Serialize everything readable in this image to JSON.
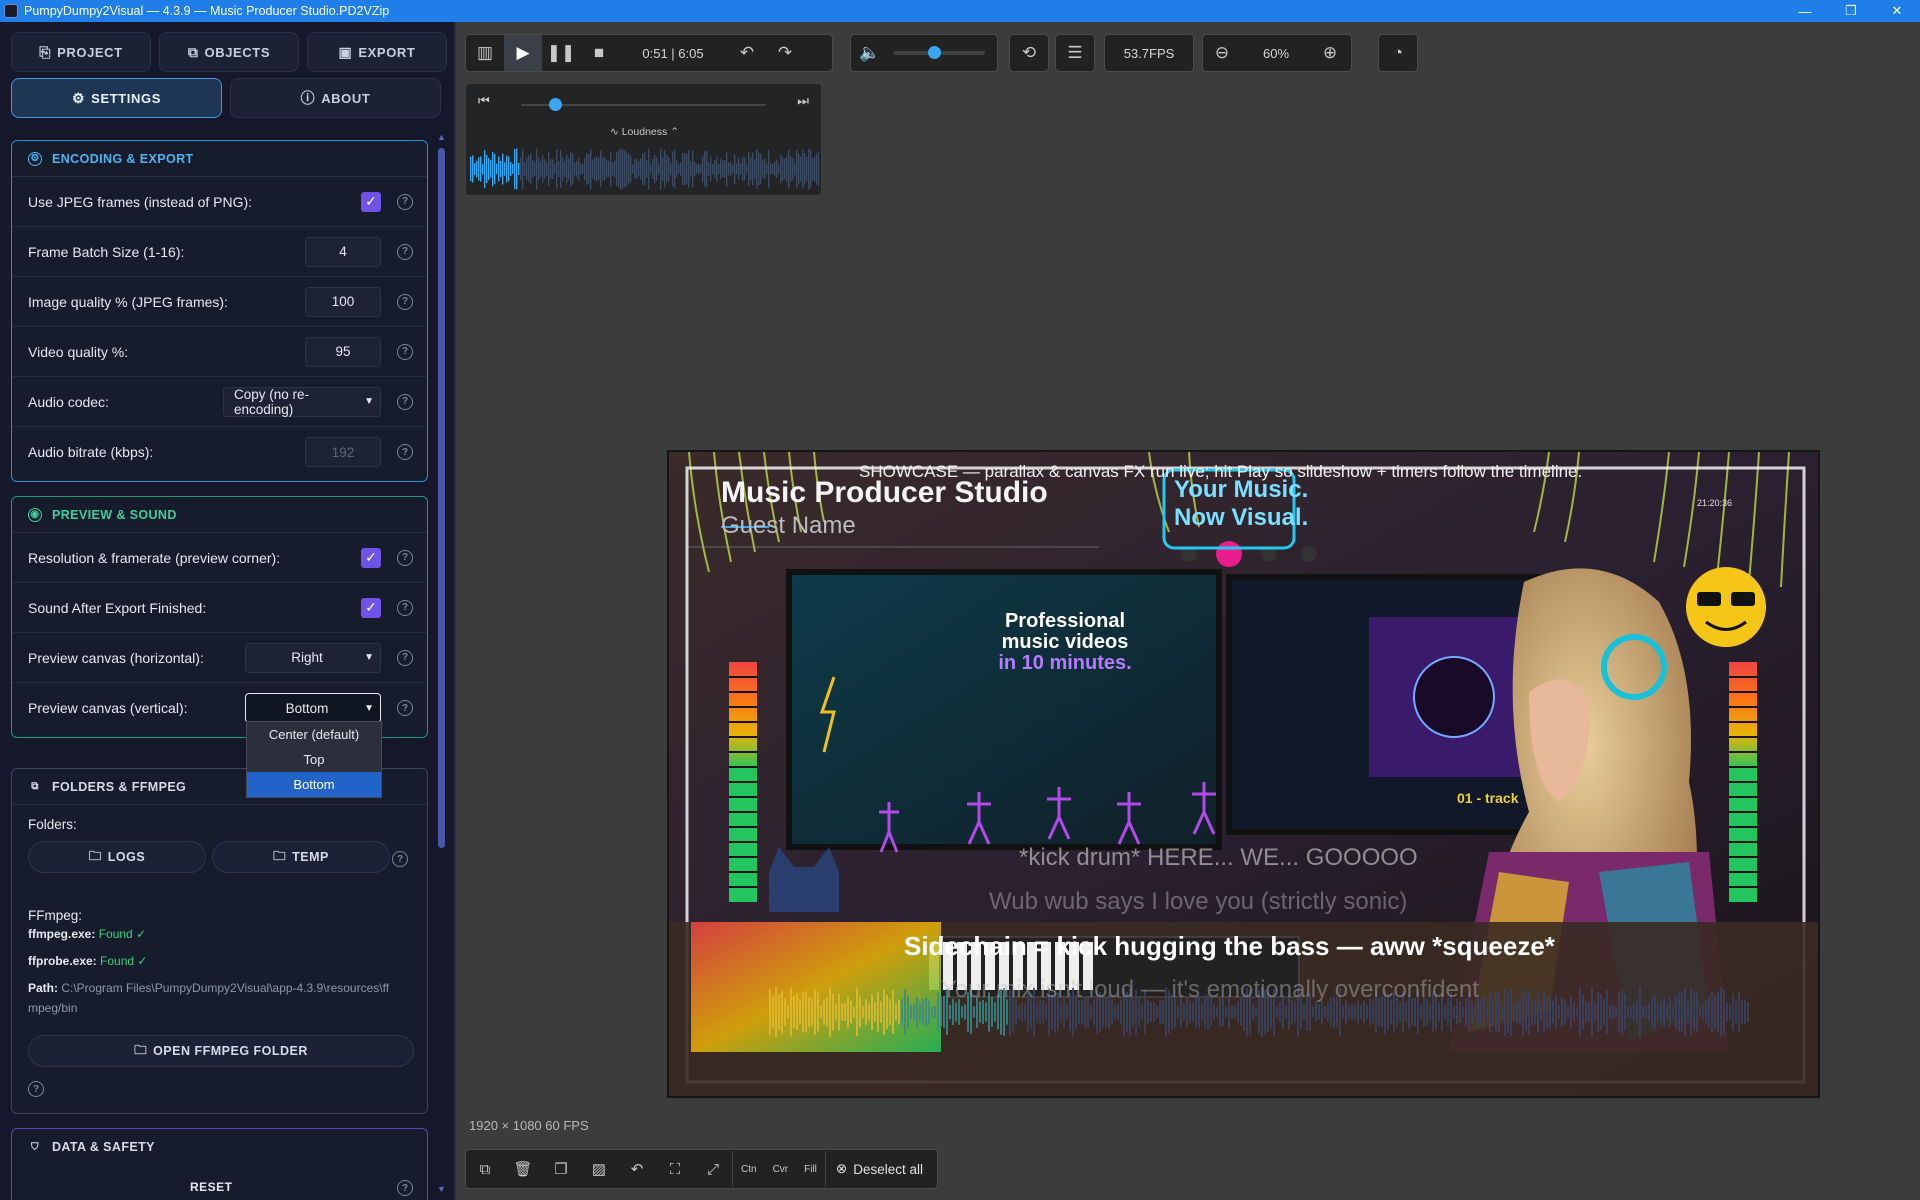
{
  "titlebar": {
    "title": "PumpyDumpy2Visual — 4.3.9 — Music Producer Studio.PD2VZip",
    "minimize": "—",
    "maximize": "❐",
    "close": "✕"
  },
  "sidebar": {
    "nav": [
      {
        "label": "PROJECT",
        "icon": "project-icon"
      },
      {
        "label": "OBJECTS",
        "icon": "objects-icon"
      },
      {
        "label": "EXPORT",
        "icon": "export-icon"
      }
    ],
    "nav2": [
      {
        "label": "SETTINGS",
        "icon": "gear-icon",
        "active": true
      },
      {
        "label": "ABOUT",
        "icon": "help-icon"
      }
    ],
    "encoding": {
      "title": "ENCODING & EXPORT",
      "rows": [
        {
          "label": "Use JPEG frames (instead of PNG):",
          "type": "checkbox",
          "checked": true
        },
        {
          "label": "Frame Batch Size (1-16):",
          "type": "number",
          "value": "4"
        },
        {
          "label": "Image quality % (JPEG frames):",
          "type": "number",
          "value": "100"
        },
        {
          "label": "Video quality %:",
          "type": "number",
          "value": "95"
        },
        {
          "label": "Audio codec:",
          "type": "select",
          "value": "Copy (no re-encoding)"
        },
        {
          "label": "Audio bitrate (kbps):",
          "type": "number",
          "value": "192",
          "disabled": true
        }
      ]
    },
    "preview_sound": {
      "title": "PREVIEW & SOUND",
      "rows": [
        {
          "label": "Resolution & framerate (preview corner):",
          "type": "checkbox",
          "checked": true
        },
        {
          "label": "Sound After Export Finished:",
          "type": "checkbox",
          "checked": true
        },
        {
          "label": "Preview canvas (horizontal):",
          "type": "select",
          "value": "Right"
        },
        {
          "label": "Preview canvas (vertical):",
          "type": "select",
          "value": "Bottom"
        }
      ],
      "dropdown_options": [
        "Center (default)",
        "Top",
        "Bottom"
      ],
      "dropdown_selected": "Bottom"
    },
    "folders": {
      "title": "FOLDERS & FFMPEG",
      "folders_label": "Folders:",
      "logs_button": "LOGS",
      "temp_button": "TEMP",
      "ffmpeg_label": "FFmpeg:",
      "ffmpeg_exe": "ffmpeg.exe:",
      "ffprobe_exe": "ffprobe.exe:",
      "found": "Found ✓",
      "path_label": "Path:",
      "path_value_1": "C:\\Program Files\\PumpyDumpy2Visual\\app-4.3.9\\resources\\ff",
      "path_value_2": "mpeg/bin",
      "open_button": "OPEN FFMPEG FOLDER"
    },
    "data_safety": {
      "title": "DATA & SAFETY",
      "reset": "RESET"
    },
    "help_glyph": "?"
  },
  "toolbar": {
    "time": "0:51 | 6:05",
    "fps": "53.7FPS",
    "zoom": "60%",
    "volume_level": 0.45
  },
  "waveform": {
    "label": "Loudness",
    "seek_position": 0.14
  },
  "preview": {
    "resolution_caption": "1920 × 1080   60 FPS",
    "showcase_text": "SHOWCASE — parallax & canvas FX run live; hit Play so slideshow + timers follow the timeline.",
    "studio_title": "Music Producer Studio",
    "guest_name": "Guest Name",
    "clock": "21:20:36",
    "neon_sign_1": "Your Music.",
    "neon_sign_2": "Now Visual.",
    "monitor_headline_1": "Professional",
    "monitor_headline_2": "music videos",
    "monitor_headline_3": "in 10 minutes.",
    "monitor_right_label": "01 - track",
    "lyric_1": "*kick drum* HERE... WE... GOOOOO",
    "lyric_2": "Wub wub says I love you (strictly sonic)",
    "lyric_3": "Sidechain = kick hugging the bass — aww *squeeze*",
    "lyric_4": "Your mix isn't loud — it's emotionally overconfident"
  },
  "bottom_toolbar": {
    "ctn": "Ctn",
    "cvr": "Cvr",
    "fill": "Fill",
    "deselect": "Deselect all"
  },
  "colors": {
    "accent_blue": "#3aa6f0",
    "checkbox_purple": "#6f52e6",
    "found_green": "#3ecf7a",
    "titlebar_blue": "#1f7ee8"
  }
}
